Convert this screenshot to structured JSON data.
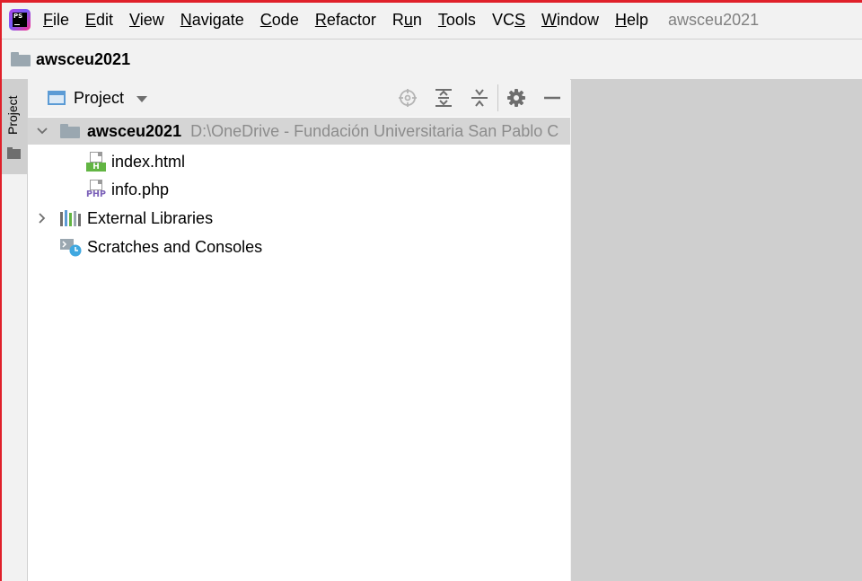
{
  "menubar": {
    "items": [
      {
        "pre": "",
        "mn": "F",
        "post": "ile"
      },
      {
        "pre": "",
        "mn": "E",
        "post": "dit"
      },
      {
        "pre": "",
        "mn": "V",
        "post": "iew"
      },
      {
        "pre": "",
        "mn": "N",
        "post": "avigate"
      },
      {
        "pre": "",
        "mn": "C",
        "post": "ode"
      },
      {
        "pre": "",
        "mn": "R",
        "post": "efactor"
      },
      {
        "pre": "R",
        "mn": "u",
        "post": "n"
      },
      {
        "pre": "",
        "mn": "T",
        "post": "ools"
      },
      {
        "pre": "VC",
        "mn": "S",
        "post": ""
      },
      {
        "pre": "",
        "mn": "W",
        "post": "indow"
      },
      {
        "pre": "",
        "mn": "H",
        "post": "elp"
      }
    ],
    "project_title": "awsceu2021"
  },
  "logo": {
    "text": "PS"
  },
  "navbar": {
    "crumb": "awsceu2021"
  },
  "tool_stripe": {
    "project_label": "Project"
  },
  "panel": {
    "title": "Project",
    "tree": {
      "root": {
        "name": "awsceu2021",
        "path": "D:\\OneDrive - Fundación Universitaria San Pablo C"
      },
      "files": [
        {
          "name": "index.html",
          "badge": "H"
        },
        {
          "name": "info.php",
          "badge": "PHP"
        }
      ],
      "external_libraries": "External Libraries",
      "scratches": "Scratches and Consoles"
    }
  },
  "colors": {
    "accent": "#e0202a",
    "selection": "#d5d5d5",
    "html_badge": "#62b543",
    "php_badge": "#7a5fb8",
    "folder": "#9aa7b0",
    "scratch_clock": "#40a8e0"
  }
}
